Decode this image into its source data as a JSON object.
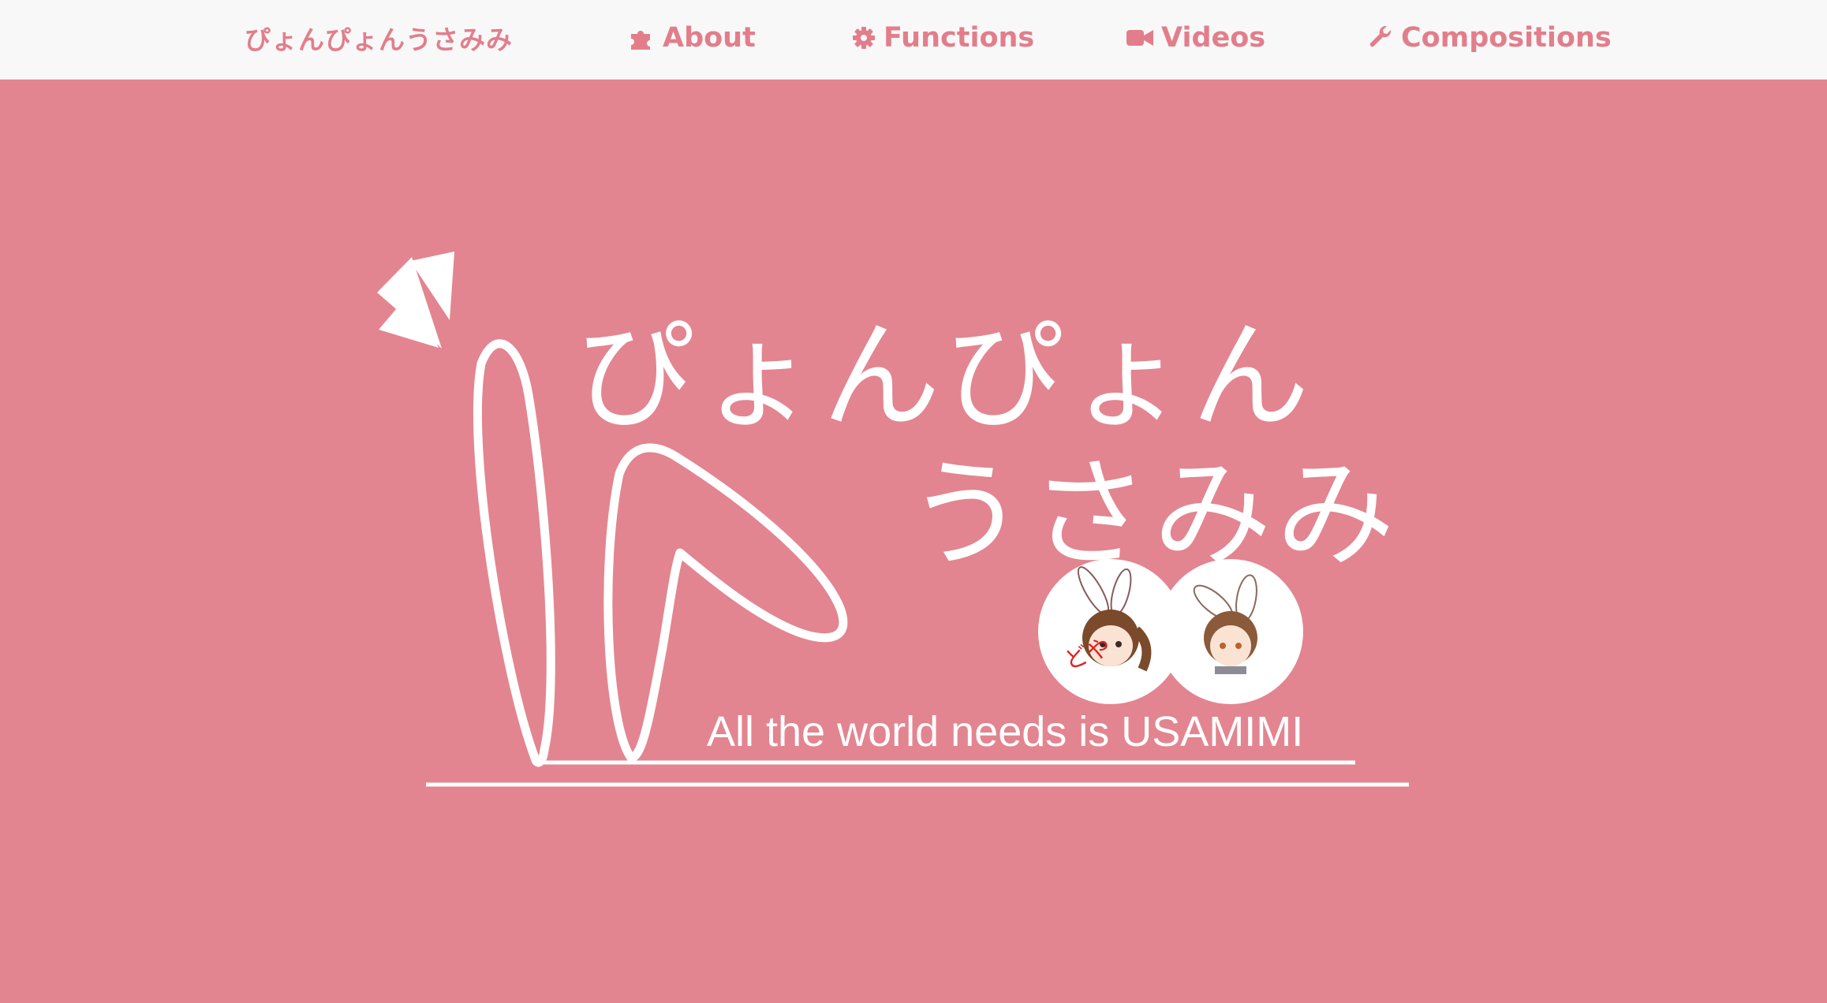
{
  "navbar": {
    "brand": "ぴょんぴょんうさみみ",
    "items": [
      {
        "label": "About",
        "icon": "puzzle-icon"
      },
      {
        "label": "Functions",
        "icon": "gear-icon"
      },
      {
        "label": "Videos",
        "icon": "video-camera-icon"
      },
      {
        "label": "Compositions",
        "icon": "wrench-icon"
      }
    ]
  },
  "hero": {
    "title_line1": "ぴょんぴょん",
    "title_line2": "うさみみ",
    "tagline": "All the world needs is USAMIMI",
    "avatar_text": "どや"
  },
  "colors": {
    "background": "#e28590",
    "accent": "#e27e8b",
    "navbar_bg": "#f8f8f8"
  }
}
